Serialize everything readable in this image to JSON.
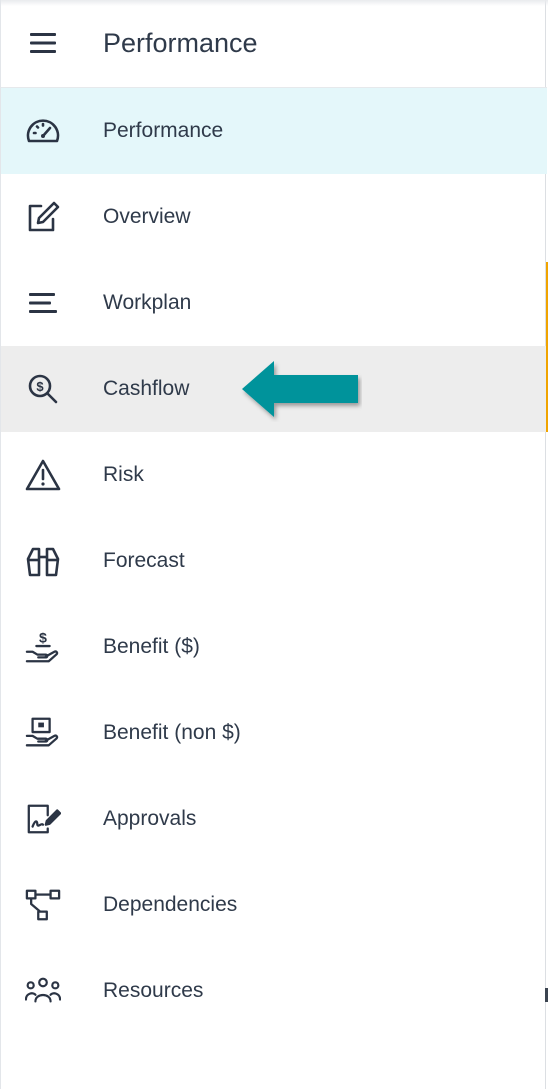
{
  "header": {
    "title": "Performance",
    "menu_icon": "hamburger-menu-icon"
  },
  "menu": {
    "active_item": "Performance",
    "hovered_item": "Cashflow",
    "items": [
      {
        "label": "Performance",
        "icon": "speedometer-icon"
      },
      {
        "label": "Overview",
        "icon": "edit-icon"
      },
      {
        "label": "Workplan",
        "icon": "list-icon"
      },
      {
        "label": "Cashflow",
        "icon": "dollar-search-icon"
      },
      {
        "label": "Risk",
        "icon": "warning-icon"
      },
      {
        "label": "Forecast",
        "icon": "binoculars-icon"
      },
      {
        "label": "Benefit ($)",
        "icon": "dollar-hand-icon"
      },
      {
        "label": "Benefit (non $)",
        "icon": "box-hand-icon"
      },
      {
        "label": "Approvals",
        "icon": "document-sign-icon"
      },
      {
        "label": "Dependencies",
        "icon": "dependency-tree-icon"
      },
      {
        "label": "Resources",
        "icon": "people-icon"
      }
    ]
  },
  "annotation": {
    "arrow_color": "#05939b",
    "points_to": "Cashflow"
  },
  "colors": {
    "active_background": "#e4f7fa",
    "hover_background": "#ededed",
    "text": "#2f3a4a",
    "accent": "#f0a400"
  }
}
